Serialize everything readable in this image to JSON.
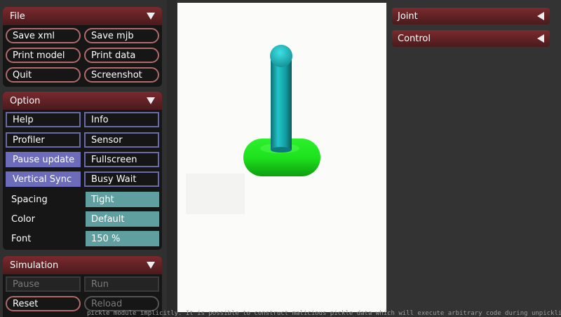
{
  "file_panel": {
    "title": "File",
    "buttons": [
      "Save xml",
      "Save mjb",
      "Print model",
      "Print data",
      "Quit",
      "Screenshot"
    ]
  },
  "option_panel": {
    "title": "Option",
    "toggles": [
      {
        "label": "Help",
        "on": false
      },
      {
        "label": "Info",
        "on": false
      },
      {
        "label": "Profiler",
        "on": false
      },
      {
        "label": "Sensor",
        "on": false
      },
      {
        "label": "Pause update",
        "on": true
      },
      {
        "label": "Fullscreen",
        "on": false
      },
      {
        "label": "Vertical Sync",
        "on": true
      },
      {
        "label": "Busy Wait",
        "on": false
      }
    ],
    "selects": [
      {
        "label": "Spacing",
        "value": "Tight"
      },
      {
        "label": "Color",
        "value": "Default"
      },
      {
        "label": "Font",
        "value": "150 %"
      }
    ]
  },
  "simulation_panel": {
    "title": "Simulation",
    "buttons": [
      {
        "label": "Pause",
        "enabled": false
      },
      {
        "label": "Run",
        "enabled": false
      },
      {
        "label": "Reset",
        "enabled": true
      },
      {
        "label": "Reload",
        "enabled": false
      }
    ]
  },
  "right_panels": {
    "joint": {
      "title": "Joint"
    },
    "control": {
      "title": "Control"
    }
  },
  "scene": {
    "pole_color": "#1aa6aa",
    "base_color": "#1ee21e",
    "background": "#fbfbf9"
  },
  "log_line": "pickle module implicitly. It is possible to construct malicious pickle data which will execute arbitrary code during unpickling (see"
}
